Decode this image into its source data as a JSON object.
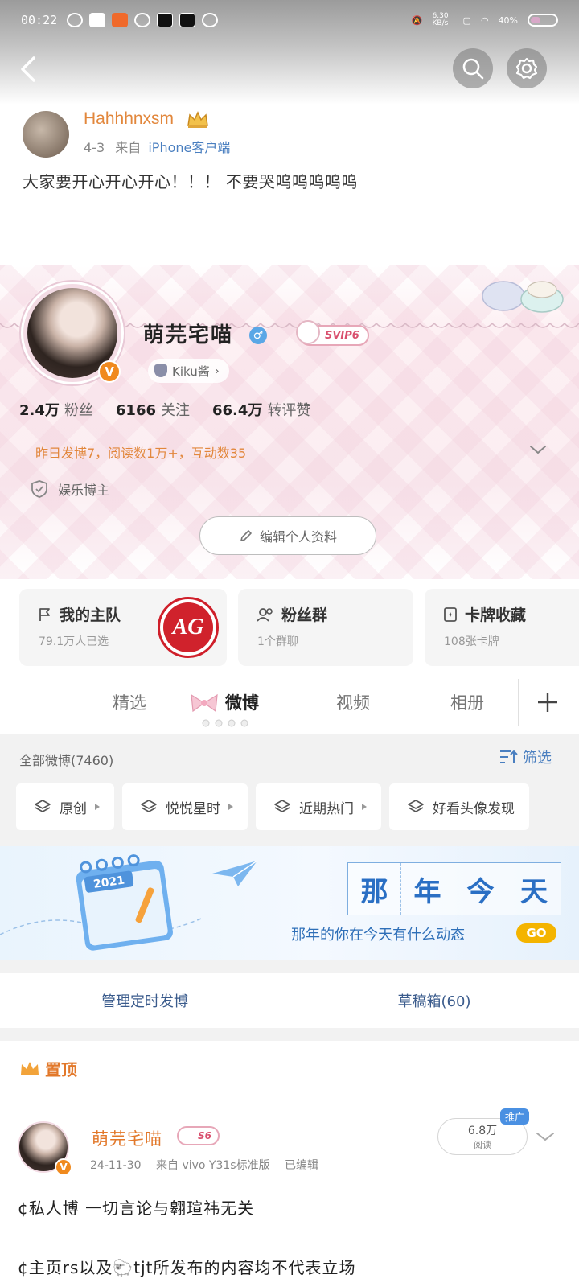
{
  "status_bar": {
    "time": "00:22",
    "net_speed": "6.30 KB/s",
    "battery": "40%",
    "battery_level": 0.4
  },
  "header": {
    "back_icon": "chevron-left-icon",
    "search_icon": "search-icon",
    "settings_icon": "gear-icon"
  },
  "repost_snippet": {
    "username": "Hahhhnxsm",
    "date": "4-3",
    "source_prefix": "来自",
    "source": "iPhone客户端",
    "text": "大家要开心开心开心！！！ 不要哭呜呜呜呜呜"
  },
  "profile": {
    "name": "萌芫宅喵",
    "gender": "♂",
    "svip_badge": "SVIP6",
    "verified_badge": "V",
    "group_tag": "Kiku酱",
    "stats": [
      {
        "value": "2.4万",
        "label": "粉丝"
      },
      {
        "value": "6166",
        "label": "关注"
      },
      {
        "value": "66.4万",
        "label": "转评赞"
      }
    ],
    "activity": "昨日发博7，阅读数1万+，互动数35",
    "tag": "娱乐博主",
    "edit_button": "编辑个人资料"
  },
  "feature_cards": [
    {
      "title": "我的主队",
      "subtitle": "79.1万人已选",
      "icon": "flag-icon",
      "logo_text": "AG"
    },
    {
      "title": "粉丝群",
      "subtitle": "1个群聊",
      "icon": "group-icon"
    },
    {
      "title": "卡牌收藏",
      "subtitle": "108张卡牌",
      "icon": "card-icon"
    }
  ],
  "tabs": {
    "items": [
      "精选",
      "微博",
      "视频",
      "相册"
    ],
    "active": "微博",
    "add_icon": "plus-icon"
  },
  "feed_filter": {
    "label": "全部微博(7460)",
    "filter_button": "筛选",
    "chips": [
      "原创",
      "悦悦星时",
      "近期热门",
      "好看头像发现"
    ]
  },
  "banner": {
    "title_chars": [
      "那",
      "年",
      "今",
      "天"
    ],
    "caption": "那年的你在今天有什么动态",
    "go_button": "GO",
    "calendar_year": "2021"
  },
  "manage": {
    "scheduled": "管理定时发博",
    "drafts": "草稿箱(60)"
  },
  "pinned_post": {
    "pin_label": "置顶",
    "username": "萌芫宅喵",
    "level_badge": "S6",
    "date": "24-11-30",
    "source": "来自 vivo Y31s标准版",
    "edited": "已编辑",
    "reads_value": "6.8万",
    "reads_label": "阅读",
    "promo_label": "推广",
    "line1": "¢私人博 一切言论与翱瑄祎无关",
    "line2": "¢主页rs以及🐑tjt所发布的内容均不代表立场"
  },
  "colors": {
    "accent_orange": "#e2873c",
    "link_blue": "#4a7fc0",
    "banner_blue": "#2a6fc4"
  }
}
